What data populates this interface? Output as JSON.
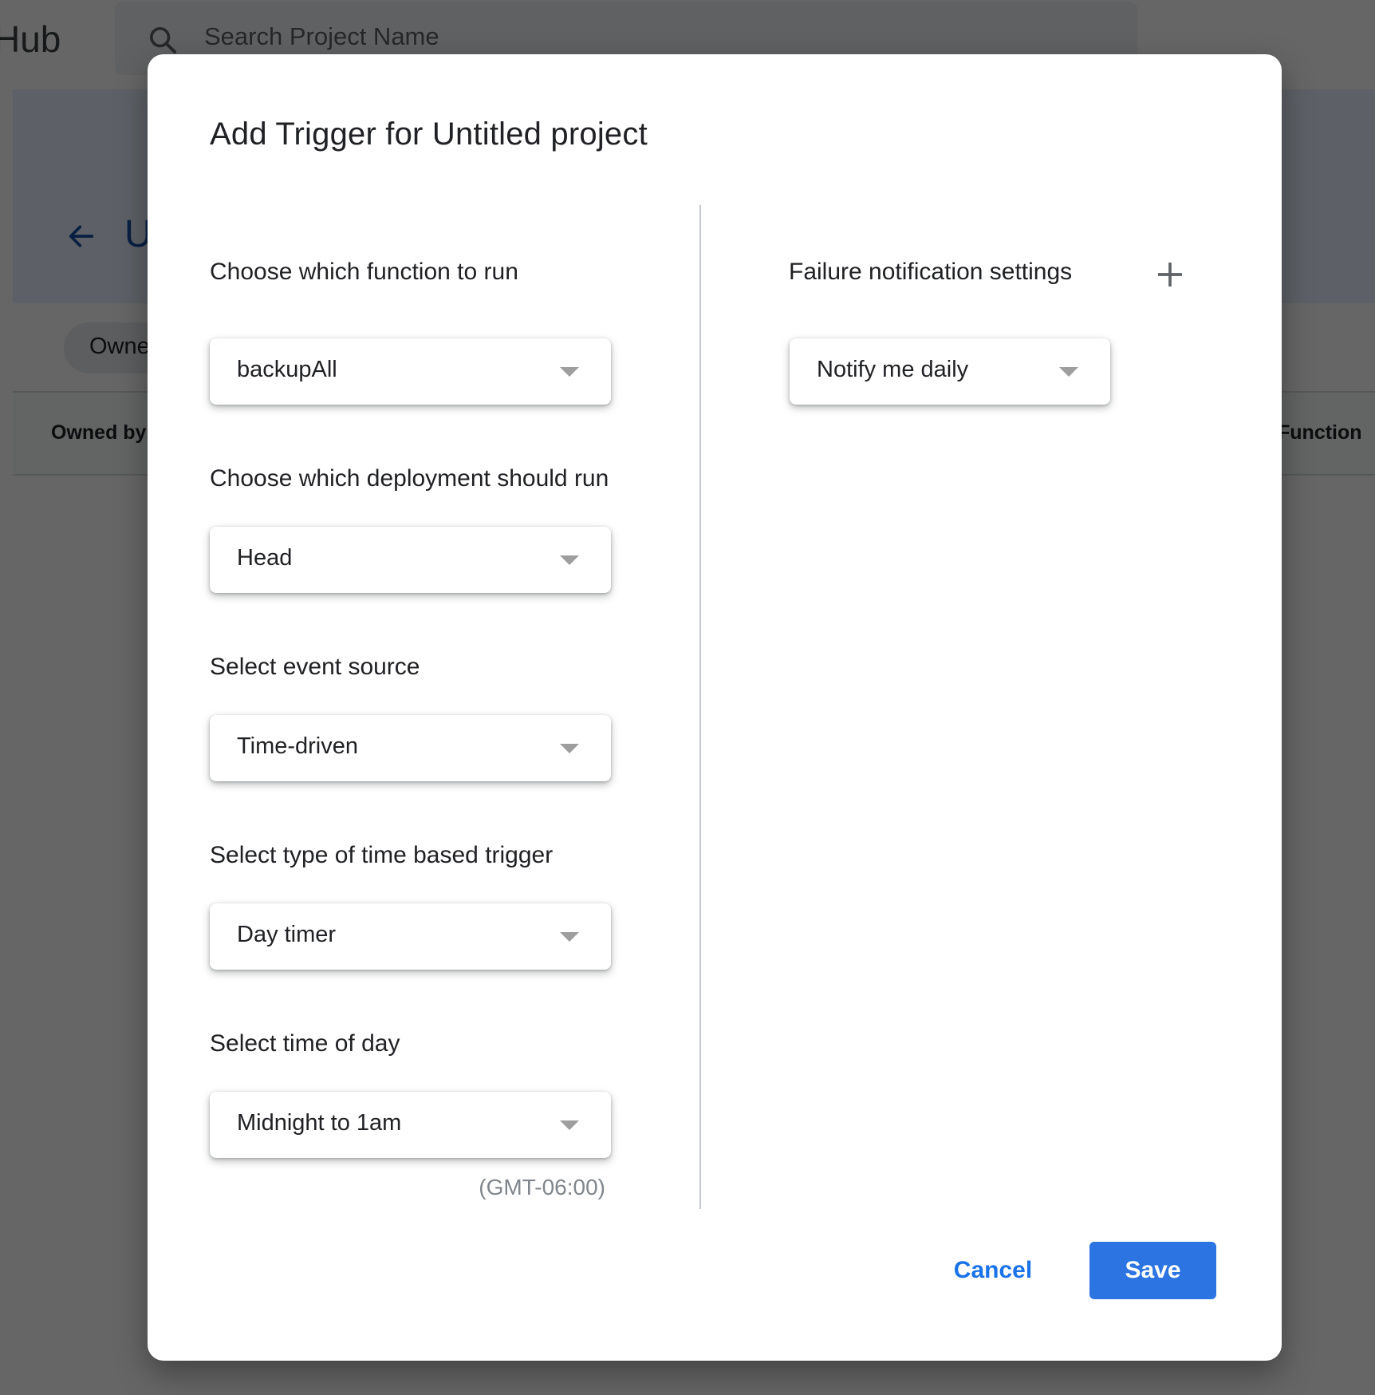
{
  "background": {
    "app_name_fragment": "Hub",
    "search_placeholder": "Search Project Name",
    "project_title_fragment": "U",
    "filter_chip_fragment": "Owne",
    "table_columns": [
      "Owned by",
      "Function"
    ]
  },
  "dialog": {
    "title": "Add Trigger for Untitled project",
    "fields": [
      {
        "label": "Choose which function to run",
        "value": "backupAll"
      },
      {
        "label": "Choose which deployment should run",
        "value": "Head"
      },
      {
        "label": "Select event source",
        "value": "Time-driven"
      },
      {
        "label": "Select type of time based trigger",
        "value": "Day timer"
      },
      {
        "label": "Select time of day",
        "value": "Midnight to 1am"
      }
    ],
    "timezone": "(GMT-06:00)",
    "failure_notification": {
      "label": "Failure notification settings",
      "add_icon": "plus-icon",
      "value": "Notify me daily"
    },
    "buttons": {
      "cancel": "Cancel",
      "save": "Save"
    }
  },
  "colors": {
    "primary": "#1a73e8",
    "save_button": "#2b74e1",
    "text": "#202124",
    "muted": "#80868b"
  }
}
